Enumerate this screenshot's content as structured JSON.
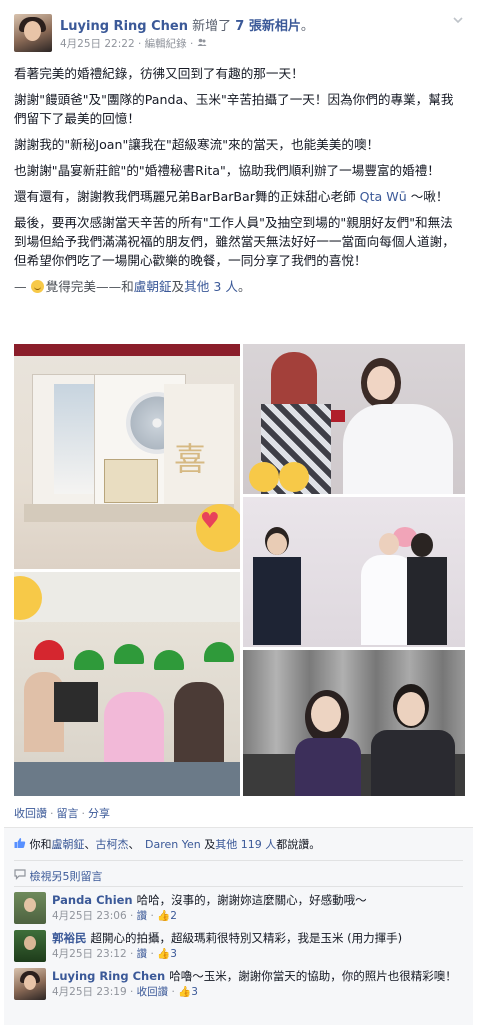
{
  "post": {
    "author": "Luying Ring Chen",
    "action": "新增了",
    "action_count": "7 張新相片",
    "action_suffix": "。",
    "timestamp": "4月25日 22:22",
    "edit_history": "編輯紀錄",
    "privacy_icon": "friends-icon",
    "menu_icon": "chevron-down-icon",
    "paragraphs": [
      "看著完美的婚禮紀錄，彷彿又回到了有趣的那一天！",
      "謝謝\"饅頭爸\"及\"團隊的Panda、玉米\"辛苦拍攝了一天！因為你們的專業，幫我們留下了最美的回憶！",
      "謝謝我的\"新秘Joan\"讓我在\"超級寒流\"來的當天，也能美美的噢！",
      "也謝謝\"晶宴新莊館\"的\"婚禮秘書Rita\"，協助我們順利辦了一場豐富的婚禮！"
    ],
    "paragraph_mention_prefix": "還有還有，謝謝教我們瑪麗兄弟BarBarBar舞的正妹甜心老師 ",
    "mention_name": "Qta Wū",
    "paragraph_mention_suffix": " ～啾！",
    "closing_paragraph": "最後，要再次感謝當天辛苦的所有\"工作人員\"及抽空到場的\"親朋好友們\"和無法到場但給予我們滿滿祝福的朋友們，雖然當天無法好好一一當面向每個人道謝，但希望你們吃了一場開心歡樂的晚餐，一同分享了我們的喜悅！",
    "feeling_prefix": "— ",
    "feeling_text": "覺得完美——和",
    "tagged_name": "盧朝鉦",
    "tagged_join": "及",
    "tagged_others": "其他 3 人",
    "feeling_suffix": "。"
  },
  "actions": {
    "withdraw_like": "收回讚",
    "comment": "留言",
    "share": "分享",
    "separator": "·"
  },
  "likes": {
    "prefix": "你和",
    "names": [
      "盧朝鉦",
      "古柯杰",
      "Daren Yen"
    ],
    "separator": "、",
    "join": "及",
    "others": "其他 119 人",
    "suffix": "都說讚。"
  },
  "view_more_comments": "檢視另5則留言",
  "comments": [
    {
      "author": "Panda Chien",
      "text": "哈哈，沒事的，謝謝妳這麼關心，好感動哦～",
      "time": "4月25日 23:06",
      "like_label": "讚",
      "like_count": "2"
    },
    {
      "author": "郭裕民",
      "text": "超開心的拍攝，超級瑪莉很特別又精彩，我是玉米 (用力揮手)",
      "time": "4月25日 23:12",
      "like_label": "讚",
      "like_count": "3"
    },
    {
      "author": "Luying Ring Chen",
      "text": "哈嚕～玉米，謝謝你當天的協助，你的照片也很精彩噢！",
      "time": "4月25日 23:19",
      "like_label": "收回讚",
      "like_count": "3"
    }
  ],
  "photos": [
    {
      "subject": "wedding-album-dvd"
    },
    {
      "subject": "bride-makeup"
    },
    {
      "subject": "couple-ceremony"
    },
    {
      "subject": "mario-costume-group"
    },
    {
      "subject": "couple-portrait"
    }
  ],
  "colors": {
    "link": "#3b5998",
    "meta": "#90949c",
    "like_blue": "#5890ff",
    "ufi_bg": "#f6f7f9"
  }
}
